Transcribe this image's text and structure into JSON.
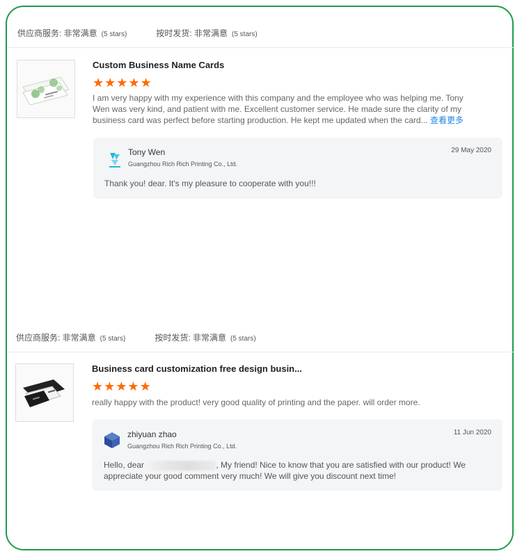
{
  "reviews": [
    {
      "supplier_label": "供应商服务: 非常满意",
      "supplier_stars": "(5 stars)",
      "delivery_label": "按时发货: 非常满意",
      "delivery_stars": "(5 stars)",
      "product_image_icon": "business-cards-green-leaves",
      "title": "Custom Business Name Cards",
      "rating": 5,
      "comment": "I am very happy with my experience with this company and the employee who was helping me. Tony Wen was very kind, and patient with me. Excellent customer service. He made sure the clarity of my business card was perfect before starting production. He kept me updated when the card...",
      "more_link": "查看更多",
      "reply": {
        "avatar_icon": "company-logo-cyan",
        "name": "Tony Wen",
        "company": "Guangzhou Rich Rich Printing Co., Ltd.",
        "date": "29 May 2020",
        "text": "Thank you! dear. It's my pleasure to cooperate with you!!!"
      }
    },
    {
      "supplier_label": "供应商服务: 非常满意",
      "supplier_stars": "(5 stars)",
      "delivery_label": "按时发货: 非常满意",
      "delivery_stars": "(5 stars)",
      "product_image_icon": "business-cards-black",
      "title": "Business card customization free design busin...",
      "rating": 5,
      "comment": "really happy with the product! very good quality of printing and the paper. will order more.",
      "reply": {
        "avatar_icon": "company-logo-blue-cube",
        "name": "zhiyuan zhao",
        "company": "Guangzhou Rich Rich Printing Co., Ltd.",
        "date": "11 Jun 2020",
        "text_before": "Hello, dear ",
        "text_after": ", My friend! Nice to know that you are satisfied with our product! We appreciate your good comment very much! We will give you discount next time!"
      }
    }
  ],
  "colors": {
    "frame_border": "#1f9a4b",
    "star": "#ff6a00",
    "link": "#1e88e5",
    "reply_bg": "#f4f5f7"
  }
}
